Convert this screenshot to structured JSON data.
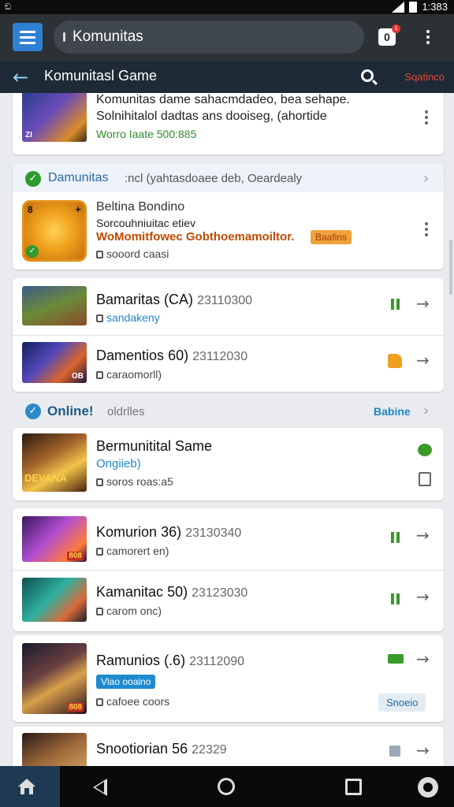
{
  "status_bar": {
    "left_icon": "cat-icon",
    "time": "1:383"
  },
  "app_bar": {
    "search_value": "Komunitas",
    "notif_count": "0",
    "notif_badge": "1"
  },
  "title_bar": {
    "title": "Komunitasl Game",
    "action": "Sqatinco"
  },
  "featured": {
    "line1": "Komunitas dame sahacmdadeo, bea sehape.",
    "line2": "Solnihitalol dadtas ans dooiseg, (ahortide",
    "line3": "Worro Iaate 500:885"
  },
  "promo": {
    "header": "Damunitas",
    "header_sub": ":ncl (yahtasdoaee deb, Oeardealy",
    "title": "Beltina Bondino",
    "line2": "Sorcouhniuitac etiev",
    "line3": "WoMomitfowec Gobthoemamoiltor.",
    "tag": "Baafins",
    "meta": "sooord caasi",
    "thumb_badge": "8"
  },
  "list_one": [
    {
      "name": "Bamaritas",
      "tag": "(CA)",
      "num": "23110300",
      "sub": "sandakeny",
      "status_color": "#3a9a2a"
    },
    {
      "name": "Damentios",
      "tag": "60)",
      "num": "23112030",
      "sub": "caraomorll)",
      "status_color": "#f0a020"
    }
  ],
  "online_section": {
    "title": "Online!",
    "sub": "oldrlles",
    "action": "Babine"
  },
  "online_featured": {
    "name": "Bermunitital Same",
    "sub": "Ongiieb)",
    "meta": "soros roas:a5",
    "thumb_text": "DEVANA"
  },
  "list_two": [
    {
      "name": "Komurion",
      "tag": "36)",
      "num": "23130340",
      "meta": "camorert en)",
      "badge": "808"
    },
    {
      "name": "Kamanitac",
      "tag": "50)",
      "num": "23123030",
      "meta": "carom onc)"
    }
  ],
  "rafmunios": {
    "name": "Ramunios",
    "tag": "(.6)",
    "num": "23112090",
    "pill": "Vlao ooaino",
    "meta": "cafoee coors",
    "button": "Snoeio",
    "badge": "808"
  },
  "last_row": {
    "name": "Snootiorian",
    "tag": "56",
    "num": "22329"
  }
}
